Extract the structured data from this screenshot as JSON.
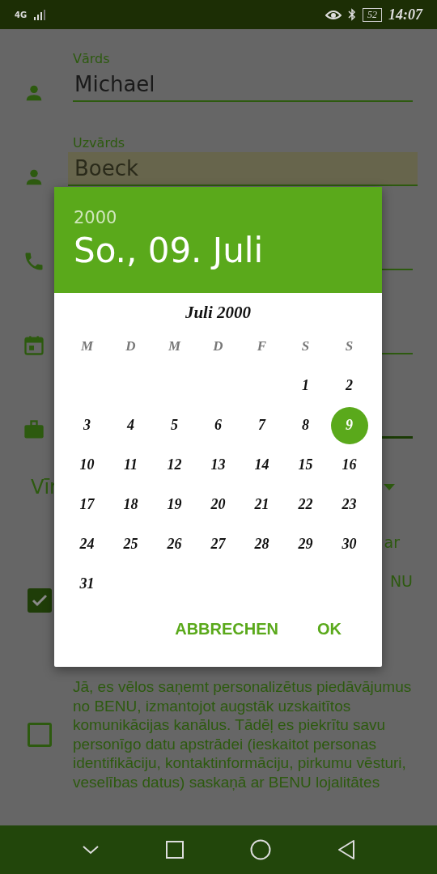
{
  "status_bar": {
    "network": "4G",
    "battery": "52",
    "time": "14:07"
  },
  "form": {
    "fields": [
      {
        "kind": "person",
        "label": "Vārds",
        "value": "Michael",
        "highlighted": false
      },
      {
        "kind": "person",
        "label": "Uzvārds",
        "value": "Boeck",
        "highlighted": true
      },
      {
        "kind": "phone",
        "focused": false
      },
      {
        "kind": "calendar",
        "focused": false
      },
      {
        "kind": "briefcase",
        "focused": true
      }
    ],
    "dropdown": {
      "value": "Vīr"
    },
    "consents": [
      {
        "lines": [
          "ar",
          "NU"
        ],
        "checked": true
      },
      {
        "lines": [
          "Jā, es vēlos saņemt personalizētus piedāvājumus no BENU, izmantojot augstāk uzskaitītos komunikācijas kanālus. Tādēļ es piekrītu savu personīgo datu apstrādei (ieskaitot personas identifikāciju, kontaktinformāciju, pirkumu vēsturi, veselības datus) saskaņā ar BENU lojalitātes"
        ],
        "checked": false
      }
    ]
  },
  "date_picker": {
    "year": "2000",
    "date": "So., 09. Juli",
    "month": "Juli 2000",
    "weekdays": [
      "M",
      "D",
      "M",
      "D",
      "F",
      "S",
      "S"
    ],
    "weeks": [
      [
        {
          "day": "1",
          "selected": false
        },
        {
          "day": "2",
          "selected": false
        }
      ],
      [
        {
          "day": "3",
          "selected": false
        },
        {
          "day": "4",
          "selected": false
        },
        {
          "day": "5",
          "selected": false
        },
        {
          "day": "6",
          "selected": false
        },
        {
          "day": "7",
          "selected": false
        },
        {
          "day": "8",
          "selected": false
        },
        {
          "day": "9",
          "selected": true
        }
      ],
      [
        {
          "day": "10",
          "selected": false
        },
        {
          "day": "11",
          "selected": false
        },
        {
          "day": "12",
          "selected": false
        },
        {
          "day": "13",
          "selected": false
        },
        {
          "day": "14",
          "selected": false
        },
        {
          "day": "15",
          "selected": false
        },
        {
          "day": "16",
          "selected": false
        }
      ],
      [
        {
          "day": "17",
          "selected": false
        },
        {
          "day": "18",
          "selected": false
        },
        {
          "day": "19",
          "selected": false
        },
        {
          "day": "20",
          "selected": false
        },
        {
          "day": "21",
          "selected": false
        },
        {
          "day": "22",
          "selected": false
        },
        {
          "day": "23",
          "selected": false
        }
      ],
      [
        {
          "day": "24",
          "selected": false
        },
        {
          "day": "25",
          "selected": false
        },
        {
          "day": "26",
          "selected": false
        },
        {
          "day": "27",
          "selected": false
        },
        {
          "day": "28",
          "selected": false
        },
        {
          "day": "29",
          "selected": false
        },
        {
          "day": "30",
          "selected": false
        }
      ],
      [
        {
          "day": "31",
          "selected": false
        }
      ]
    ],
    "buttons": [
      "ABBRECHEN",
      "OK"
    ]
  }
}
